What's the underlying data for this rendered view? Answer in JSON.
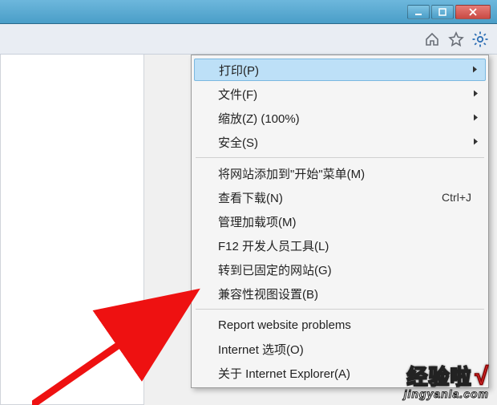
{
  "titlebar": {
    "minimize": "minimize",
    "maximize": "maximize",
    "close": "close"
  },
  "toolbar": {
    "home": "home",
    "favorites": "favorites",
    "tools": "tools"
  },
  "menu": {
    "group1": [
      {
        "label": "打印(P)",
        "submenu": true,
        "highlight": true
      },
      {
        "label": "文件(F)",
        "submenu": true
      },
      {
        "label": "缩放(Z) (100%)",
        "submenu": true
      },
      {
        "label": "安全(S)",
        "submenu": true
      }
    ],
    "group2": [
      {
        "label": "将网站添加到\"开始\"菜单(M)"
      },
      {
        "label": "查看下载(N)",
        "shortcut": "Ctrl+J"
      },
      {
        "label": "管理加载项(M)"
      },
      {
        "label": "F12 开发人员工具(L)"
      },
      {
        "label": "转到已固定的网站(G)"
      },
      {
        "label": "兼容性视图设置(B)"
      }
    ],
    "group3": [
      {
        "label": "Report website problems"
      },
      {
        "label": "Internet 选项(O)"
      },
      {
        "label": "关于 Internet Explorer(A)"
      }
    ]
  },
  "watermark": {
    "brand": "经验啦",
    "url": "jingyanla.com"
  }
}
